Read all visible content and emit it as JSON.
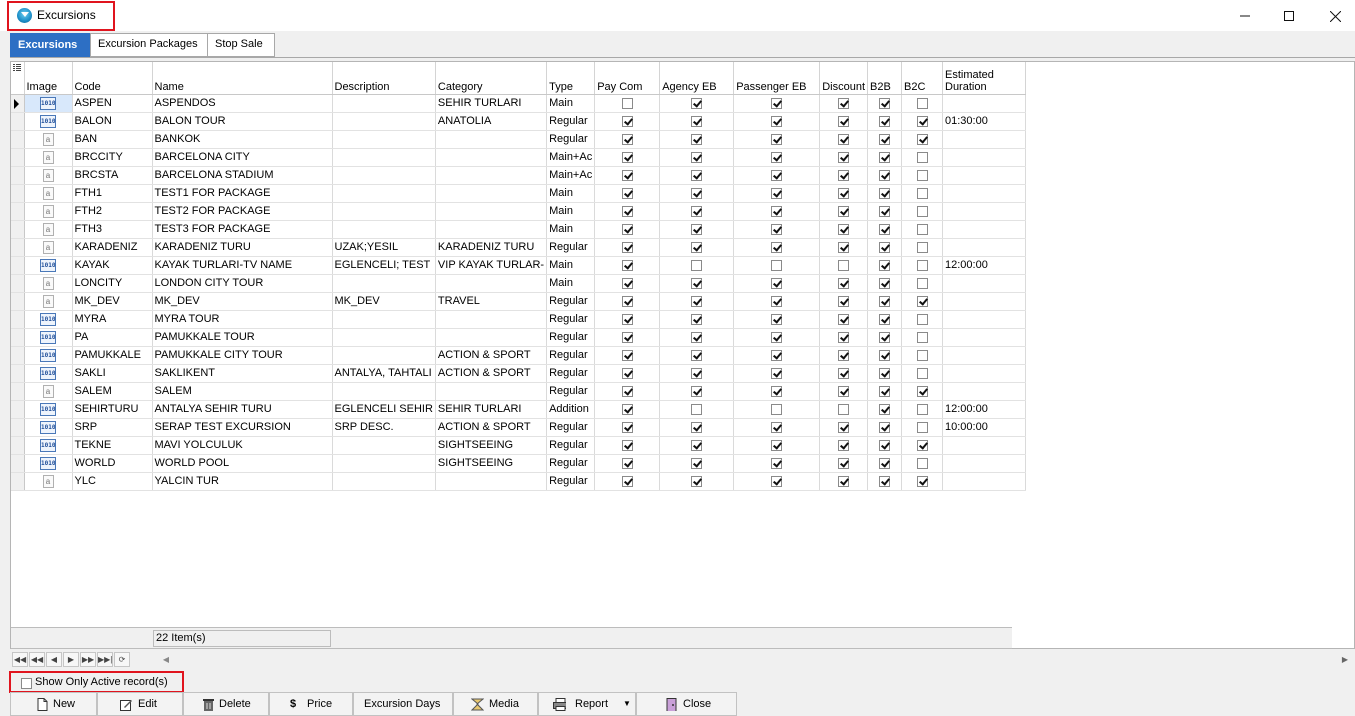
{
  "window": {
    "title": "Excursions"
  },
  "tabs": [
    {
      "label": "Excursions",
      "active": true
    },
    {
      "label": "Excursion Packages",
      "active": false
    },
    {
      "label": "Stop Sale",
      "active": false
    }
  ],
  "grid": {
    "columns": [
      "Image",
      "Code",
      "Name",
      "Description",
      "Category",
      "Type",
      "Pay Com",
      "Agency EB",
      "Passenger EB",
      "Discount",
      "B2B",
      "B2C",
      "Estimated Duration"
    ],
    "estimated_duration_header": [
      "Estimated",
      "Duration"
    ],
    "rows": [
      {
        "img": "bin",
        "code": "ASPEN",
        "name": "ASPENDOS",
        "description": "",
        "category": "SEHIR TURLARI",
        "type": "Main",
        "pay_com": false,
        "agency_eb": true,
        "passenger_eb": true,
        "discount": true,
        "b2b": true,
        "b2c": false,
        "duration": ""
      },
      {
        "img": "bin",
        "code": "BALON",
        "name": "BALON TOUR",
        "description": "",
        "category": "ANATOLIA",
        "type": "Regular",
        "pay_com": true,
        "agency_eb": true,
        "passenger_eb": true,
        "discount": true,
        "b2b": true,
        "b2c": true,
        "duration": "01:30:00"
      },
      {
        "img": "txt",
        "code": "BAN",
        "name": "BANKOK",
        "description": "",
        "category": "",
        "type": "Regular",
        "pay_com": true,
        "agency_eb": true,
        "passenger_eb": true,
        "discount": true,
        "b2b": true,
        "b2c": true,
        "duration": ""
      },
      {
        "img": "txt",
        "code": "BRCCITY",
        "name": "BARCELONA CITY",
        "description": "",
        "category": "",
        "type": "Main+Ac",
        "pay_com": true,
        "agency_eb": true,
        "passenger_eb": true,
        "discount": true,
        "b2b": true,
        "b2c": false,
        "duration": ""
      },
      {
        "img": "txt",
        "code": "BRCSTA",
        "name": "BARCELONA STADIUM",
        "description": "",
        "category": "",
        "type": "Main+Ac",
        "pay_com": true,
        "agency_eb": true,
        "passenger_eb": true,
        "discount": true,
        "b2b": true,
        "b2c": false,
        "duration": ""
      },
      {
        "img": "txt",
        "code": "FTH1",
        "name": "TEST1 FOR PACKAGE",
        "description": "",
        "category": "",
        "type": "Main",
        "pay_com": true,
        "agency_eb": true,
        "passenger_eb": true,
        "discount": true,
        "b2b": true,
        "b2c": false,
        "duration": ""
      },
      {
        "img": "txt",
        "code": "FTH2",
        "name": "TEST2 FOR PACKAGE",
        "description": "",
        "category": "",
        "type": "Main",
        "pay_com": true,
        "agency_eb": true,
        "passenger_eb": true,
        "discount": true,
        "b2b": true,
        "b2c": false,
        "duration": ""
      },
      {
        "img": "txt",
        "code": "FTH3",
        "name": "TEST3 FOR PACKAGE",
        "description": "",
        "category": "",
        "type": "Main",
        "pay_com": true,
        "agency_eb": true,
        "passenger_eb": true,
        "discount": true,
        "b2b": true,
        "b2c": false,
        "duration": ""
      },
      {
        "img": "txt",
        "code": "KARADENIZ",
        "name": "KARADENIZ TURU",
        "description": "UZAK;YESIL",
        "category": "KARADENIZ TURU",
        "type": "Regular",
        "pay_com": true,
        "agency_eb": true,
        "passenger_eb": true,
        "discount": true,
        "b2b": true,
        "b2c": false,
        "duration": ""
      },
      {
        "img": "bin",
        "code": "KAYAK",
        "name": "KAYAK TURLARI-TV NAME",
        "description": "EGLENCELI; TEST",
        "category": "VIP KAYAK TURLAR-",
        "type": "Main",
        "pay_com": true,
        "agency_eb": false,
        "passenger_eb": false,
        "discount": false,
        "b2b": true,
        "b2c": false,
        "duration": "12:00:00"
      },
      {
        "img": "txt",
        "code": "LONCITY",
        "name": "LONDON CITY TOUR",
        "description": "",
        "category": "",
        "type": "Main",
        "pay_com": true,
        "agency_eb": true,
        "passenger_eb": true,
        "discount": true,
        "b2b": true,
        "b2c": false,
        "duration": ""
      },
      {
        "img": "txt",
        "code": "MK_DEV",
        "name": "MK_DEV",
        "description": "MK_DEV",
        "category": "TRAVEL",
        "type": "Regular",
        "pay_com": true,
        "agency_eb": true,
        "passenger_eb": true,
        "discount": true,
        "b2b": true,
        "b2c": true,
        "duration": ""
      },
      {
        "img": "bin",
        "code": "MYRA",
        "name": "MYRA TOUR",
        "description": "",
        "category": "",
        "type": "Regular",
        "pay_com": true,
        "agency_eb": true,
        "passenger_eb": true,
        "discount": true,
        "b2b": true,
        "b2c": false,
        "duration": ""
      },
      {
        "img": "bin",
        "code": "PA",
        "name": "PAMUKKALE TOUR",
        "description": "",
        "category": "",
        "type": "Regular",
        "pay_com": true,
        "agency_eb": true,
        "passenger_eb": true,
        "discount": true,
        "b2b": true,
        "b2c": false,
        "duration": ""
      },
      {
        "img": "bin",
        "code": "PAMUKKALE",
        "name": "PAMUKKALE CITY TOUR",
        "description": "",
        "category": "ACTION & SPORT",
        "type": "Regular",
        "pay_com": true,
        "agency_eb": true,
        "passenger_eb": true,
        "discount": true,
        "b2b": true,
        "b2c": false,
        "duration": ""
      },
      {
        "img": "bin",
        "code": "SAKLI",
        "name": "SAKLIKENT",
        "description": "ANTALYA, TAHTALI",
        "category": "ACTION & SPORT",
        "type": "Regular",
        "pay_com": true,
        "agency_eb": true,
        "passenger_eb": true,
        "discount": true,
        "b2b": true,
        "b2c": false,
        "duration": ""
      },
      {
        "img": "txt",
        "code": "SALEM",
        "name": "SALEM",
        "description": "",
        "category": "",
        "type": "Regular",
        "pay_com": true,
        "agency_eb": true,
        "passenger_eb": true,
        "discount": true,
        "b2b": true,
        "b2c": true,
        "duration": ""
      },
      {
        "img": "bin",
        "code": "SEHIRTURU",
        "name": "ANTALYA SEHIR TURU",
        "description": "EGLENCELI SEHIR",
        "category": "SEHIR TURLARI",
        "type": "Addition",
        "pay_com": true,
        "agency_eb": false,
        "passenger_eb": false,
        "discount": false,
        "b2b": true,
        "b2c": false,
        "duration": "12:00:00"
      },
      {
        "img": "bin",
        "code": "SRP",
        "name": "SERAP TEST EXCURSION",
        "description": "SRP DESC.",
        "category": "ACTION & SPORT",
        "type": "Regular",
        "pay_com": true,
        "agency_eb": true,
        "passenger_eb": true,
        "discount": true,
        "b2b": true,
        "b2c": false,
        "duration": "10:00:00"
      },
      {
        "img": "bin",
        "code": "TEKNE",
        "name": "MAVI YOLCULUK",
        "description": "",
        "category": "SIGHTSEEING",
        "type": "Regular",
        "pay_com": true,
        "agency_eb": true,
        "passenger_eb": true,
        "discount": true,
        "b2b": true,
        "b2c": true,
        "duration": ""
      },
      {
        "img": "bin",
        "code": "WORLD",
        "name": "WORLD POOL",
        "description": "",
        "category": "SIGHTSEEING",
        "type": "Regular",
        "pay_com": true,
        "agency_eb": true,
        "passenger_eb": true,
        "discount": true,
        "b2b": true,
        "b2c": false,
        "duration": ""
      },
      {
        "img": "txt",
        "code": "YLC",
        "name": "YALCIN TUR",
        "description": "",
        "category": "",
        "type": "Regular",
        "pay_com": true,
        "agency_eb": true,
        "passenger_eb": true,
        "discount": true,
        "b2b": true,
        "b2c": true,
        "duration": ""
      }
    ],
    "summary": "22 Item(s)"
  },
  "filter": {
    "show_only_active_label": "Show Only Active record(s)",
    "checked": false
  },
  "toolbar": {
    "new": "New",
    "edit": "Edit",
    "delete": "Delete",
    "price": "Price",
    "excursion_days": "Excursion Days",
    "media": "Media",
    "report": "Report",
    "close": "Close"
  },
  "icons": {
    "binary_image": "1010",
    "text_image": "a"
  },
  "colors": {
    "active_tab": "#2d6fc4",
    "highlight_border": "#e0141e"
  }
}
